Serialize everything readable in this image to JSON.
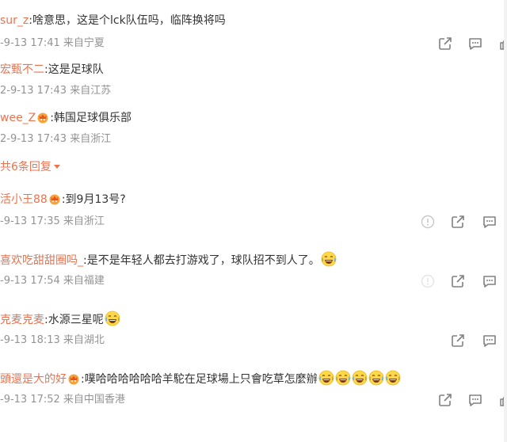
{
  "colors": {
    "username": "#eb7350",
    "text": "#333333",
    "meta": "#939393",
    "icon": "#808080"
  },
  "icons": {
    "share": "share-icon",
    "comment": "comment-icon",
    "like": "like-icon",
    "report": "report-icon",
    "vip": "vip-crown-icon",
    "laugh": "laugh-cry-emoji"
  },
  "comments": [
    {
      "user": "sur_z",
      "text": "啥意思，这是个lck队伍吗，临阵换将吗",
      "meta": "-9-13 17:41 来自宁夏"
    },
    {
      "user": "宏甄不二",
      "text": "这是足球队",
      "meta": "2-9-13 17:43 来自江苏"
    },
    {
      "user": "wee_Z",
      "text": "韩国足球俱乐部",
      "meta": "2-9-13 17:43 来自浙江"
    },
    {
      "user": "活小王88",
      "text": "到9月13号?",
      "meta": "-9-13 17:35 来自浙江"
    },
    {
      "user": "喜欢吃甜甜圈吗_",
      "text": "是不是年轻人都去打游戏了，球队招不到人了。",
      "meta": "-9-13 17:54 来自福建"
    },
    {
      "user": "克麦克麦",
      "text": "水源三星呢",
      "meta": "-9-13 18:13 来自湖北"
    },
    {
      "user": "頭還是大的好",
      "text": "噗哈哈哈哈哈哈羊駝在足球場上只會吃草怎麼辦",
      "meta": "-9-13 17:52 来自中国香港"
    }
  ],
  "more_replies": "共6条回复"
}
